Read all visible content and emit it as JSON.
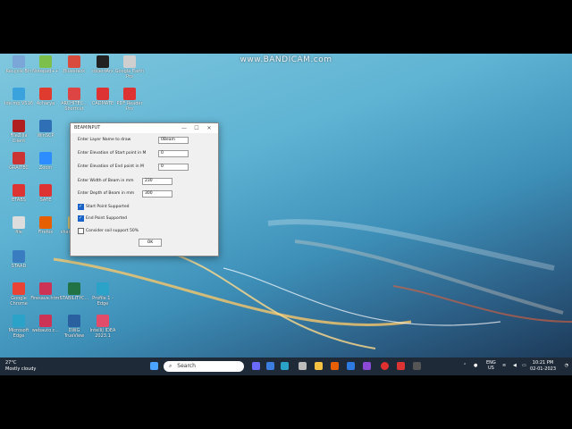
{
  "watermark": "www.BANDICAM.com",
  "desktop_icons": [
    {
      "label": "Recycle Bin",
      "color": "#7aa7d8"
    },
    {
      "label": "Notepad++",
      "color": "#7cc04b"
    },
    {
      "label": "Bluestack",
      "color": "#d94c3d"
    },
    {
      "label": "objectArx",
      "color": "#222222"
    },
    {
      "label": "Google Earth Pro",
      "color": "#cfcfcf"
    },
    {
      "label": "Ide.mp VS16",
      "color": "#3aa2dd"
    },
    {
      "label": "Acharya",
      "color": "#e03b2f"
    },
    {
      "label": "ARCHITEC... Shortcut",
      "color": "#d44"
    },
    {
      "label": "CADMATE",
      "color": "#d33"
    },
    {
      "label": "PDF Reader Pro",
      "color": "#d33"
    },
    {
      "label": "FileZilla Client",
      "color": "#b02020"
    },
    {
      "label": "WinSCP",
      "color": "#2f6fb5"
    },
    {
      "label": "GRAITEC",
      "color": "#c33"
    },
    {
      "label": "Zoom",
      "color": "#2d8cff"
    },
    {
      "label": "ETABS",
      "color": "#d33"
    },
    {
      "label": "SAFE",
      "color": "#d33"
    },
    {
      "label": "file",
      "color": "#ddd"
    },
    {
      "label": "Firefox",
      "color": "#e66000"
    },
    {
      "label": "changesto...",
      "color": "#d8c270"
    },
    {
      "label": "ExcelPr...",
      "color": "#1f7244"
    },
    {
      "label": "STAAD",
      "color": "#3a7cc0"
    },
    {
      "label": "Google Chrome",
      "color": "#e94335"
    },
    {
      "label": "Firesave.html",
      "color": "#c35"
    },
    {
      "label": "STABILITYC...",
      "color": "#217346"
    },
    {
      "label": "Profile 1 - Edge",
      "color": "#2ba3c9"
    },
    {
      "label": "Microsoft Edge",
      "color": "#2ba3c9"
    },
    {
      "label": "webauto.c...",
      "color": "#c35"
    },
    {
      "label": "DWG TrueView",
      "color": "#2a5fa0"
    },
    {
      "label": "IntelliJ IDEA 2023.1",
      "color": "#e14c6a"
    }
  ],
  "dialog": {
    "title": "BEAMINPUT",
    "controls": {
      "minimize": "—",
      "maximize": "☐",
      "close": "✕"
    },
    "fields": [
      {
        "label": "Enter Layer Name to draw",
        "value": "0Beam"
      },
      {
        "label": "Enter Elevation of Start point in M",
        "value": "0"
      },
      {
        "label": "Enter Elevation of End point in M",
        "value": "0"
      },
      {
        "label": "Enter Width of Beam in mm",
        "value": "230"
      },
      {
        "label": "Enter Depth of Beam in mm",
        "value": "300"
      }
    ],
    "checkboxes": [
      {
        "label": "Start Point Supported",
        "checked": true
      },
      {
        "label": "End Point Supported",
        "checked": true
      },
      {
        "label": "Consider soil support 50%",
        "checked": false
      }
    ],
    "ok_label": "OK"
  },
  "taskbar": {
    "weather_temp": "27°C",
    "weather_desc": "Mostly cloudy",
    "search_placeholder": "Search",
    "lang_top": "ENG",
    "lang_bottom": "US",
    "time": "10:21 PM",
    "date": "02-01-2023"
  }
}
